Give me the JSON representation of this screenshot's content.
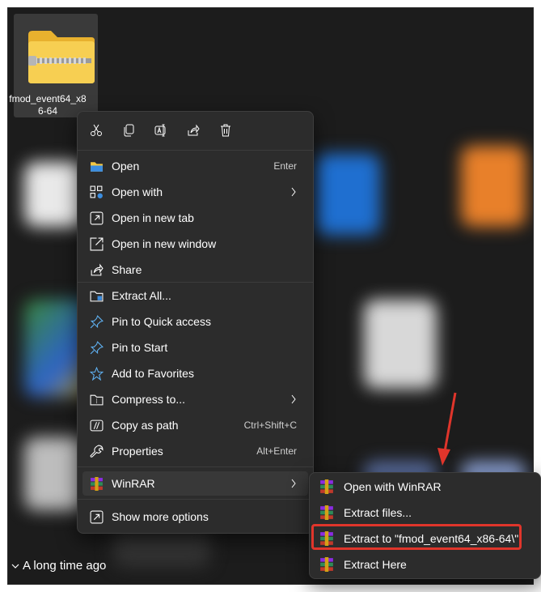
{
  "file": {
    "name_line1": "fmod_event64_x8",
    "name_line2": "6-64"
  },
  "group_header": "A long time ago",
  "quick_actions": [
    "cut-icon",
    "copy-icon",
    "rename-icon",
    "share-icon",
    "delete-icon"
  ],
  "menu": {
    "open": {
      "label": "Open",
      "shortcut": "Enter"
    },
    "open_with": {
      "label": "Open with"
    },
    "open_new_tab": {
      "label": "Open in new tab"
    },
    "open_new_window": {
      "label": "Open in new window"
    },
    "share": {
      "label": "Share"
    },
    "extract_all": {
      "label": "Extract All..."
    },
    "pin_quick": {
      "label": "Pin to Quick access"
    },
    "pin_start": {
      "label": "Pin to Start"
    },
    "add_fav": {
      "label": "Add to Favorites"
    },
    "compress": {
      "label": "Compress to..."
    },
    "copy_path": {
      "label": "Copy as path",
      "shortcut": "Ctrl+Shift+C"
    },
    "properties": {
      "label": "Properties",
      "shortcut": "Alt+Enter"
    },
    "winrar": {
      "label": "WinRAR"
    },
    "more": {
      "label": "Show more options"
    }
  },
  "submenu": {
    "open_winrar": "Open with WinRAR",
    "extract_files": "Extract files...",
    "extract_to": "Extract to \"fmod_event64_x86-64\\\"",
    "extract_here": "Extract Here"
  },
  "colors": {
    "menu_bg": "#2c2c2c",
    "highlight": "#e0352b",
    "folder": "#f5c842"
  }
}
